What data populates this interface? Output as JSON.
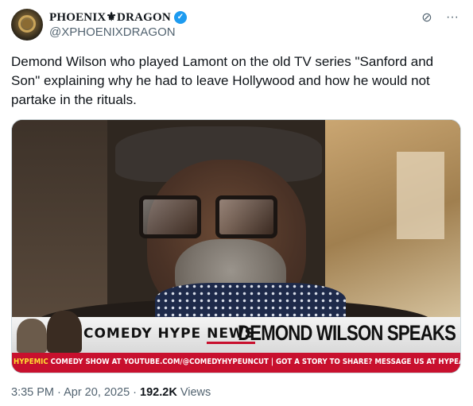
{
  "author": {
    "display_name": "PHOENIX⚜DRAGON",
    "handle": "@XPHOENIXDRAGON",
    "verified": true,
    "verified_color": "#1d9bf0"
  },
  "top_actions": [
    {
      "icon": "grok-icon",
      "glyph": "⊘"
    },
    {
      "icon": "more-icon",
      "glyph": "···"
    }
  ],
  "tweet": {
    "text": "Demond Wilson who played Lamont on the old TV series \"Sanford and Son\" explaining why he had to leave Hollywood and how he would not partake in the rituals."
  },
  "media": {
    "banner_left": "COMEDY HYPE ",
    "banner_news": "NEWS",
    "banner_right": "DEMOND WILSON SPEAKS",
    "ticker_brand": "HYPEMIC",
    "ticker_text": " COMEDY SHOW AT YOUTUBE.COM/@COMEDYHYPEUNCUT  |  GOT A STORY TO SHARE? MESSAGE US AT HYPEALERTS.COM  |  SHOP",
    "ticker_color": "#c8102e"
  },
  "meta": {
    "time": "3:35 PM",
    "separator1": " · ",
    "date": "Apr 20, 2025",
    "separator2": " · ",
    "views_count": "192.2K",
    "views_label": " Views"
  }
}
